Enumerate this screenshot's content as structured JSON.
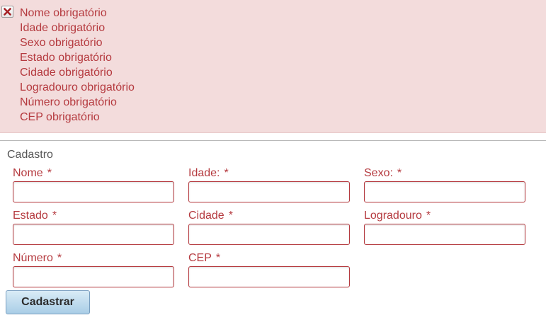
{
  "errors": {
    "icon": "close-icon",
    "items": [
      "Nome obrigatório",
      "Idade obrigatório",
      "Sexo obrigatório",
      "Estado obrigatório",
      "Cidade obrigatório",
      "Logradouro obrigatório",
      "Número obrigatório",
      "CEP obrigatório"
    ]
  },
  "form": {
    "legend": "Cadastro",
    "required_marker": "*",
    "fields": [
      {
        "label": "Nome",
        "value": ""
      },
      {
        "label": "Idade:",
        "value": ""
      },
      {
        "label": "Sexo:",
        "value": ""
      },
      {
        "label": "Estado",
        "value": ""
      },
      {
        "label": "Cidade",
        "value": ""
      },
      {
        "label": "Logradouro",
        "value": ""
      },
      {
        "label": "Número",
        "value": ""
      },
      {
        "label": "CEP",
        "value": ""
      }
    ],
    "submit_label": "Cadastrar"
  },
  "colors": {
    "error_background": "#f3dcdc",
    "error_text": "#b53a3f",
    "input_border": "#b53a3f",
    "button_top": "#d9ebf6",
    "button_bottom": "#a9cde6"
  }
}
